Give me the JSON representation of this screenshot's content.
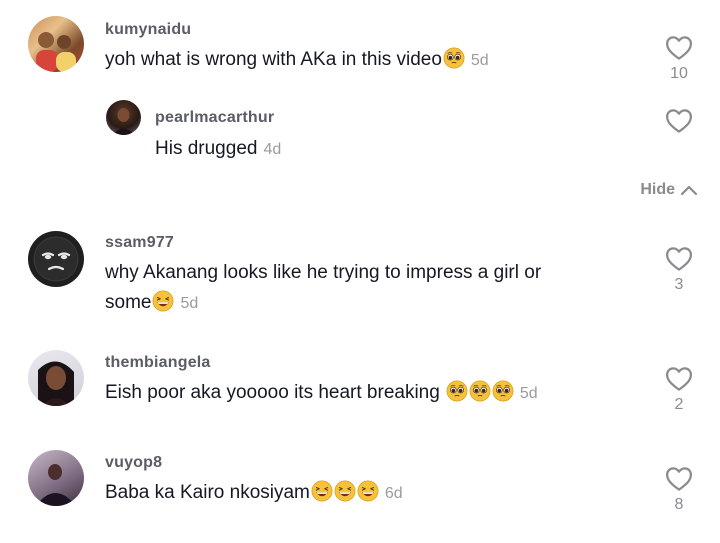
{
  "comments": [
    {
      "username": "kumynaidu",
      "text": "yoh what is wrong with AKa in this video",
      "emoji": [
        "pleading"
      ],
      "time": "5d",
      "likes": "10"
    },
    {
      "username": "pearlmacarthur",
      "text": "His drugged",
      "emoji": [],
      "time": "4d",
      "likes": ""
    },
    {
      "username": "ssam977",
      "text_line1": "why Akanang looks like he trying to impress a girl or",
      "text_line2": "some",
      "emoji": [
        "grin-squint"
      ],
      "time": "5d",
      "likes": "3"
    },
    {
      "username": "thembiangela",
      "text": "Eish poor aka yooooo its heart breaking",
      "emoji": [
        "pleading",
        "pleading",
        "pleading"
      ],
      "time": "5d",
      "likes": "2"
    },
    {
      "username": "vuyop8",
      "text": "Baba ka Kairo nkosiyam",
      "emoji": [
        "grin-squint",
        "grin-squint",
        "grin-squint"
      ],
      "time": "6d",
      "likes": "8"
    }
  ],
  "replies_toggle": {
    "label": "Hide",
    "icon": "chevron-up-icon"
  },
  "icons": {
    "like": "heart-outline-icon"
  },
  "colors": {
    "text": "#161823",
    "muted": "#8a8b91",
    "emoji": "#f7c23b"
  }
}
